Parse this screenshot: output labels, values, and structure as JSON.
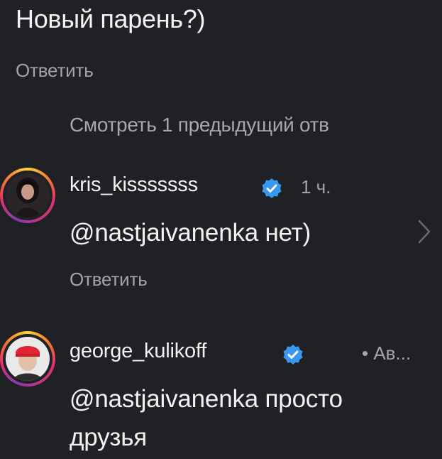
{
  "previous_comment": {
    "text": "Новый парень?)",
    "reply_label": "Ответить"
  },
  "view_previous_replies": "Смотреть 1 предыдущий отв",
  "comments": [
    {
      "username": "kris_kisssssss",
      "verified": true,
      "time": "1 ч.",
      "text": "@nastjaivanenka нет)",
      "reply_label": "Ответить",
      "avatar_icon": "user-avatar-photo"
    },
    {
      "username": "george_kulikoff",
      "verified": true,
      "time": "• Ав...",
      "text_line1": "@nastjaivanenka просто",
      "text_line2": "друзья",
      "avatar_icon": "user-avatar-photo"
    }
  ],
  "icons": {
    "verified_badge": "verified-badge-icon",
    "chevron": "chevron-right-icon"
  },
  "colors": {
    "background": "#202124",
    "text": "#f2f2f2",
    "secondary_text": "#a4a4a6",
    "verified_blue": "#3897f0"
  }
}
